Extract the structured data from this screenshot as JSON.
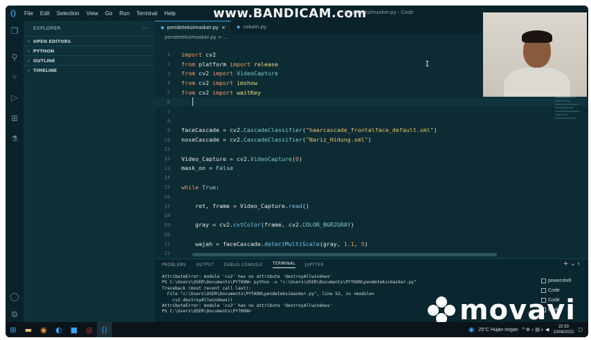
{
  "watermark_top": {
    "text": "www.BANDICAM.com"
  },
  "window_title": "pendeteksimasker.py - Code",
  "menu": [
    "File",
    "Edit",
    "Selection",
    "View",
    "Go",
    "Run",
    "Terminal",
    "Help"
  ],
  "sidebar": {
    "title": "EXPLORER",
    "more": "···",
    "sections": [
      "OPEN EDITORS",
      "PYTHON",
      "OUTLINE",
      "TIMELINE"
    ]
  },
  "tabs": [
    {
      "label": "pendeteksimasker.py",
      "close": "×"
    },
    {
      "label": "cobain.py"
    }
  ],
  "breadcrumb": "pendeteksimasker.py > ...",
  "code_lines": [
    {
      "n": "1",
      "parts": [
        [
          "kw",
          "import "
        ],
        [
          "var",
          "cv2"
        ]
      ]
    },
    {
      "n": "2",
      "parts": [
        [
          "kw",
          "from "
        ],
        [
          "var",
          "platform "
        ],
        [
          "kw",
          "import "
        ],
        [
          "fn",
          "release"
        ]
      ]
    },
    {
      "n": "3",
      "parts": [
        [
          "kw",
          "from "
        ],
        [
          "var",
          "cv2 "
        ],
        [
          "kw",
          "import "
        ],
        [
          "cls",
          "VideoCapture"
        ]
      ]
    },
    {
      "n": "4",
      "parts": [
        [
          "kw",
          "from "
        ],
        [
          "var",
          "cv2 "
        ],
        [
          "kw",
          "import "
        ],
        [
          "fn",
          "imshow"
        ]
      ]
    },
    {
      "n": "5",
      "parts": [
        [
          "kw",
          "from "
        ],
        [
          "var",
          "cv2 "
        ],
        [
          "kw",
          "import "
        ],
        [
          "fn",
          "waitKey"
        ]
      ]
    },
    {
      "n": "6",
      "parts": [],
      "current": true
    },
    {
      "n": "7",
      "parts": []
    },
    {
      "n": "8",
      "parts": []
    },
    {
      "n": "9",
      "parts": [
        [
          "var",
          "faceCascade = cv2."
        ],
        [
          "cls",
          "CascadeClassifier"
        ],
        [
          "var",
          "("
        ],
        [
          "str",
          "\"haarcascade_frontalface_default.xml\""
        ],
        [
          "var",
          ")"
        ]
      ]
    },
    {
      "n": "10",
      "parts": [
        [
          "var",
          "noseCascade = cv2."
        ],
        [
          "cls",
          "CascadeClassifier"
        ],
        [
          "var",
          "("
        ],
        [
          "str",
          "\"Nariz_Hidung.xml\""
        ],
        [
          "var",
          ")"
        ]
      ]
    },
    {
      "n": "11",
      "parts": []
    },
    {
      "n": "12",
      "parts": [
        [
          "var",
          "Video_Capture = cv2."
        ],
        [
          "cls",
          "VideoCapture"
        ],
        [
          "var",
          "("
        ],
        [
          "num",
          "0"
        ],
        [
          "var",
          ")"
        ]
      ]
    },
    {
      "n": "13",
      "parts": [
        [
          "var",
          "mask_on = "
        ],
        [
          "const",
          "False"
        ]
      ]
    },
    {
      "n": "14",
      "parts": []
    },
    {
      "n": "15",
      "parts": [
        [
          "kw",
          "while "
        ],
        [
          "const",
          "True"
        ],
        [
          "var",
          ":"
        ]
      ]
    },
    {
      "n": "16",
      "parts": []
    },
    {
      "n": "17",
      "parts": [
        [
          "var",
          "    ret, frame = Video_Capture."
        ],
        [
          "attr",
          "read"
        ],
        [
          "var",
          "()"
        ]
      ]
    },
    {
      "n": "18",
      "parts": []
    },
    {
      "n": "19",
      "parts": [
        [
          "var",
          "    gray = cv2."
        ],
        [
          "attr",
          "cvtColor"
        ],
        [
          "var",
          "(frame, cv2."
        ],
        [
          "cls",
          "COLOR_BGR2GRAY"
        ],
        [
          "var",
          ")"
        ]
      ]
    },
    {
      "n": "20",
      "parts": []
    },
    {
      "n": "21",
      "parts": [
        [
          "var",
          "    wajah = faceCascade."
        ],
        [
          "attr",
          "detectMultiScale"
        ],
        [
          "var",
          "(gray, "
        ],
        [
          "num",
          "1.1"
        ],
        [
          "var",
          ", "
        ],
        [
          "num",
          "5"
        ],
        [
          "var",
          ")"
        ]
      ]
    },
    {
      "n": "22",
      "parts": []
    }
  ],
  "cursor_glyph": "I",
  "panel": {
    "tabs": [
      "PROBLEMS",
      "OUTPUT",
      "DEBUG CONSOLE",
      "TERMINAL",
      "JUPYTER"
    ],
    "active_tab": "TERMINAL",
    "actions": "+ ⌄ ‹",
    "terminal_lines": [
      "AttributeError: module 'cv2' has no attribute 'destroyAllwindows'",
      "PS C:\\Users\\USER\\Documents\\PYTHON> python -u \"c:\\Users\\USER\\Documents\\PYTHON\\pendeteksimasker.py\"",
      "Traceback (most recent call last):",
      "  File \"c:\\Users\\USER\\Documents\\PYTHON\\pendeteksimasker.py\", line 52, in <module>",
      "    cv2.destroyAllwindows()",
      "AttributeError: module 'cv2' has no attribute 'destroyAllwindows'",
      "PS C:\\Users\\USER\\Documents\\PYTHON>"
    ],
    "terminal_instances": [
      "powershell",
      "Code",
      "Code",
      "Code"
    ]
  },
  "watermark_bottom": {
    "text": "movavi"
  },
  "taskbar": {
    "weather": "25°C  Hujan ringan",
    "time": "22:33",
    "date": "10/06/2022"
  },
  "colors": {
    "accent": "#3ca3f0",
    "background": "#0c2b33",
    "keyword": "#f29a6b",
    "string": "#e8c36a"
  }
}
